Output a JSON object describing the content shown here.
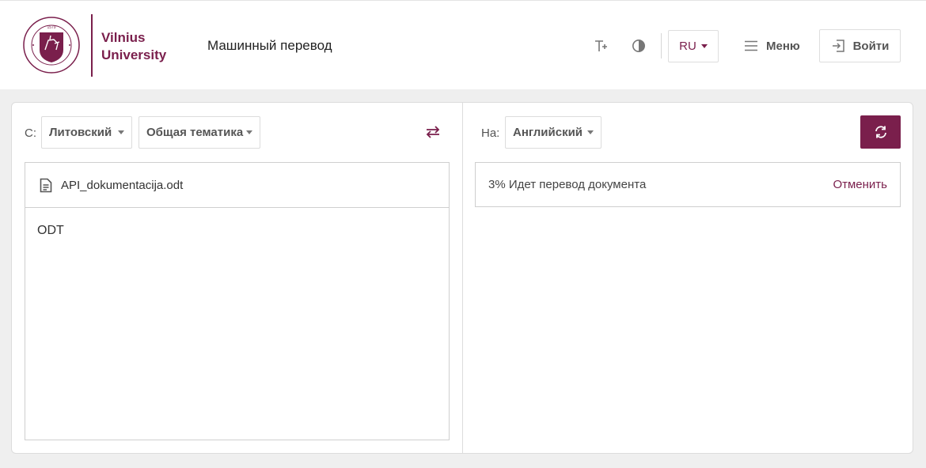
{
  "header": {
    "logo": {
      "line1": "Vilnius",
      "line2": "University",
      "seal_text_top": "VILNIAUS UNIVERSITETAS",
      "seal_text_bottom": "UNIVERSITAS VILNENSIS",
      "seal_year": "1579"
    },
    "site_title": "Машинный перевод",
    "icons": [
      "text-size-icon",
      "contrast-icon"
    ],
    "language": "RU",
    "menu_label": "Меню",
    "login_label": "Войти"
  },
  "source": {
    "from_label": "С:",
    "language": "Литовский",
    "domain": "Общая тематика",
    "file_name": "API_dokumentacija.odt",
    "file_type": "ODT"
  },
  "target": {
    "to_label": "На:",
    "language": "Английский",
    "progress_percent": 3,
    "status_text": "3% Идет перевод документа",
    "cancel_label": "Отменить"
  },
  "colors": {
    "accent": "#7a1f4c",
    "background": "#efefef",
    "border": "#dcdcdc"
  }
}
